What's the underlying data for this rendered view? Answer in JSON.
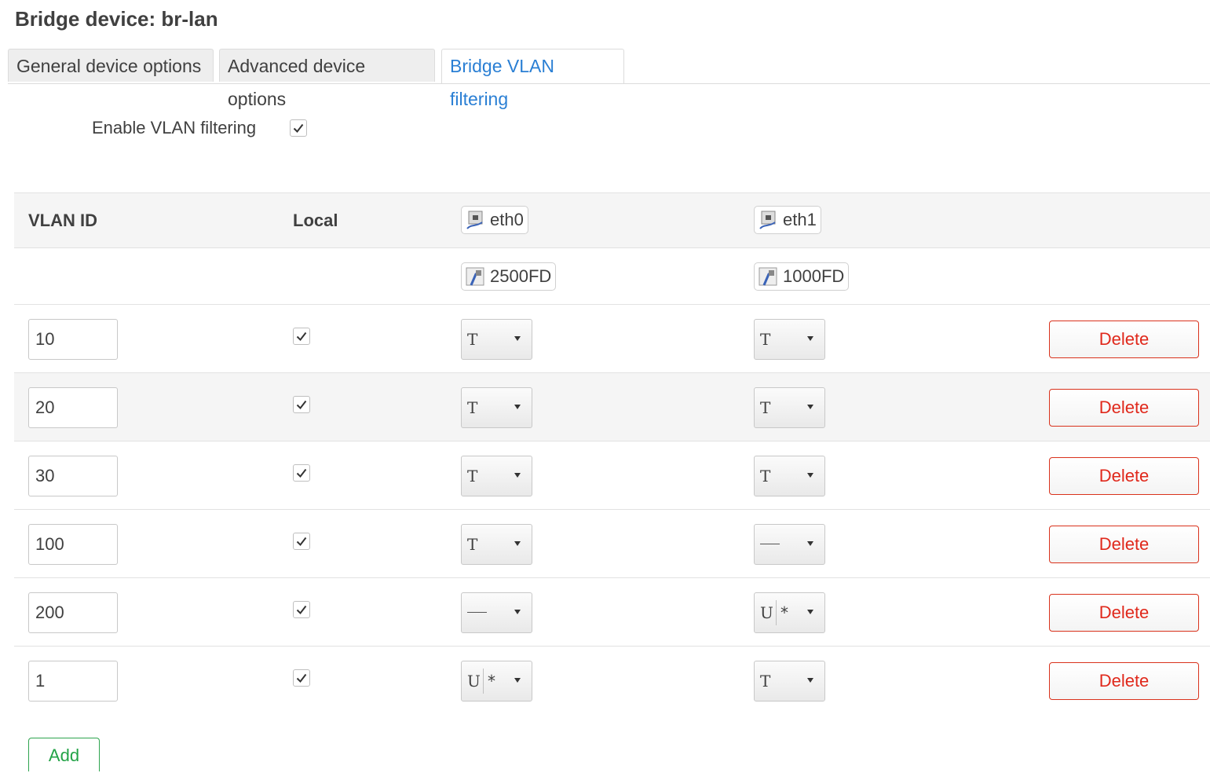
{
  "title": "Bridge device: br-lan",
  "tabs": [
    {
      "label": "General device options"
    },
    {
      "label": "Advanced device options"
    },
    {
      "label": "Bridge VLAN filtering",
      "active": true
    }
  ],
  "options": {
    "enable_vlan_filtering": {
      "label": "Enable VLAN filtering",
      "checked": true
    }
  },
  "table": {
    "headers": {
      "vlan_id": "VLAN ID",
      "local": "Local"
    },
    "ports": [
      {
        "name": "eth0",
        "speed": "2500FD"
      },
      {
        "name": "eth1",
        "speed": "1000FD"
      }
    ],
    "rows": [
      {
        "vlan_id": "10",
        "local": true,
        "eth0": "T",
        "eth1": "T"
      },
      {
        "vlan_id": "20",
        "local": true,
        "eth0": "T",
        "eth1": "T"
      },
      {
        "vlan_id": "30",
        "local": true,
        "eth0": "T",
        "eth1": "T"
      },
      {
        "vlan_id": "100",
        "local": true,
        "eth0": "T",
        "eth1": "—"
      },
      {
        "vlan_id": "200",
        "local": true,
        "eth0": "—",
        "eth1": "U",
        "eth1_pvid": "*"
      },
      {
        "vlan_id": "1",
        "local": true,
        "eth0": "U",
        "eth0_pvid": "*",
        "eth1": "T"
      }
    ],
    "delete_label": "Delete",
    "add_label": "Add"
  },
  "colors": {
    "accent": "#2a7fd4",
    "delete": "#e0281b",
    "add": "#23a347"
  },
  "icons": {
    "port": "network-port-icon",
    "speed": "ethernet-cable-icon",
    "check": "checkmark-icon"
  }
}
